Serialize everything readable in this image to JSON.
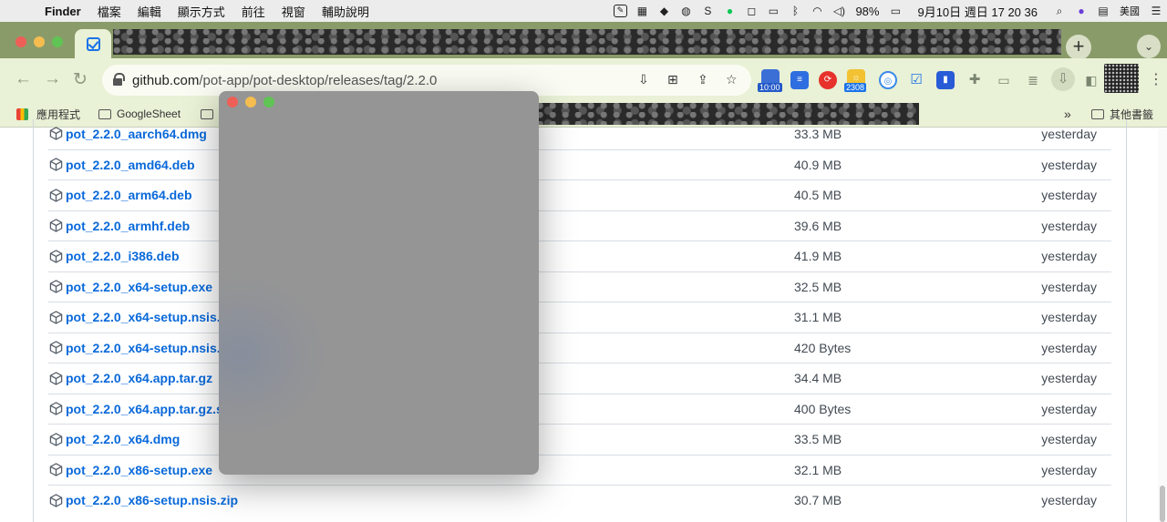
{
  "menubar": {
    "items": [
      "Finder",
      "檔案",
      "編輯",
      "顯示方式",
      "前往",
      "視窗",
      "輔助說明"
    ],
    "battery": "98%",
    "datetime": "9月10日 週日  17 20 36",
    "input_source": "美國"
  },
  "browser": {
    "url_host": "github.com",
    "url_path": "/pot-app/pot-desktop/releases/tag/2.2.0",
    "ext_badge_time": "10:00",
    "ext_badge_count": "2308"
  },
  "bookmarks": {
    "items": [
      "應用程式",
      "GoogleSheet"
    ],
    "overflow": "»",
    "other": "其他書籤"
  },
  "assets": [
    {
      "name": "pot_2.2.0_aarch64.dmg",
      "size": "33.3 MB",
      "date": "yesterday"
    },
    {
      "name": "pot_2.2.0_amd64.deb",
      "size": "40.9 MB",
      "date": "yesterday"
    },
    {
      "name": "pot_2.2.0_arm64.deb",
      "size": "40.5 MB",
      "date": "yesterday"
    },
    {
      "name": "pot_2.2.0_armhf.deb",
      "size": "39.6 MB",
      "date": "yesterday"
    },
    {
      "name": "pot_2.2.0_i386.deb",
      "size": "41.9 MB",
      "date": "yesterday"
    },
    {
      "name": "pot_2.2.0_x64-setup.exe",
      "size": "32.5 MB",
      "date": "yesterday"
    },
    {
      "name": "pot_2.2.0_x64-setup.nsis.zip",
      "size": "31.1 MB",
      "date": "yesterday"
    },
    {
      "name": "pot_2.2.0_x64-setup.nsis.zip.sig",
      "size": "420 Bytes",
      "date": "yesterday"
    },
    {
      "name": "pot_2.2.0_x64.app.tar.gz",
      "size": "34.4 MB",
      "date": "yesterday"
    },
    {
      "name": "pot_2.2.0_x64.app.tar.gz.sig",
      "size": "400 Bytes",
      "date": "yesterday"
    },
    {
      "name": "pot_2.2.0_x64.dmg",
      "size": "33.5 MB",
      "date": "yesterday"
    },
    {
      "name": "pot_2.2.0_x86-setup.exe",
      "size": "32.1 MB",
      "date": "yesterday"
    },
    {
      "name": "pot_2.2.0_x86-setup.nsis.zip",
      "size": "30.7 MB",
      "date": "yesterday"
    }
  ],
  "colors": {
    "link": "#0969da",
    "tabstrip": "#8a9b6a",
    "toolbar": "#e9f1d6",
    "overlay_window": "#959595"
  }
}
